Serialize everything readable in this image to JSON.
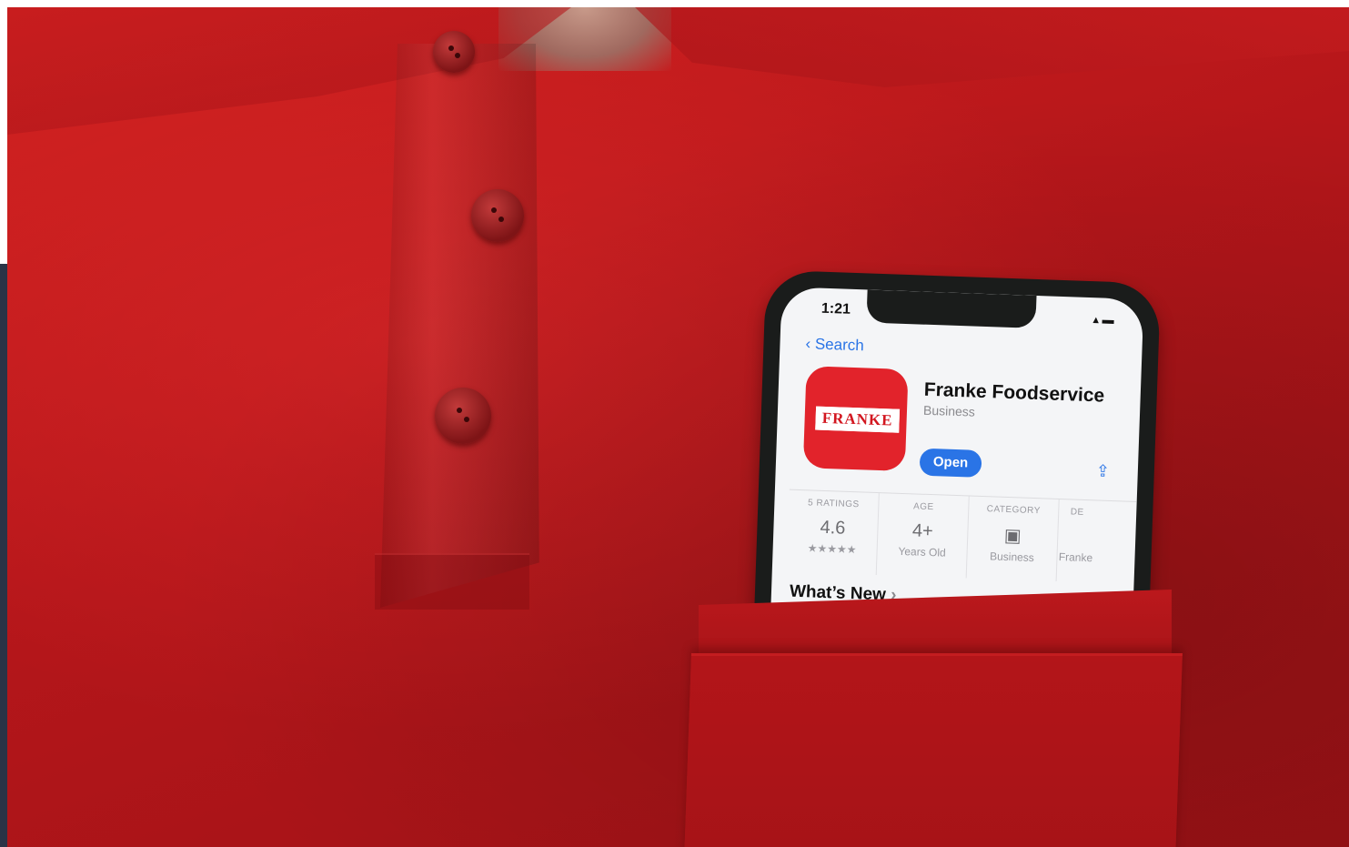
{
  "phone_screen": {
    "status_time": "1:21",
    "back_label": "Search",
    "app": {
      "logo_text": "FRANKE",
      "name": "Franke Foodservice",
      "category": "Business",
      "open_label": "Open"
    },
    "stats": [
      {
        "header": "5 RATINGS",
        "value": "4.6",
        "sub": "★★★★★"
      },
      {
        "header": "AGE",
        "value": "4+",
        "sub": "Years Old"
      },
      {
        "header": "CATEGORY",
        "value": "",
        "sub": "Business"
      },
      {
        "header": "DE",
        "value": "",
        "sub": "Franke"
      }
    ],
    "whats_new": "What’s New"
  },
  "colors": {
    "shirt": "#b5161a",
    "accent": "#2a74e6",
    "icon_red": "#e2232b"
  }
}
